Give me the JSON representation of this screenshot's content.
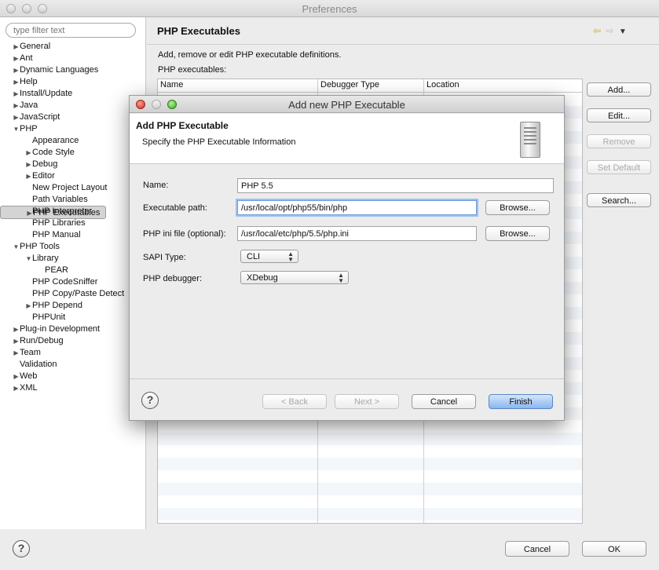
{
  "window": {
    "title": "Preferences"
  },
  "sidebar": {
    "filter_placeholder": "type filter text",
    "items": [
      {
        "label": "General",
        "depth": 0,
        "arrow": "▶"
      },
      {
        "label": "Ant",
        "depth": 0,
        "arrow": "▶"
      },
      {
        "label": "Dynamic Languages",
        "depth": 0,
        "arrow": "▶"
      },
      {
        "label": "Help",
        "depth": 0,
        "arrow": "▶"
      },
      {
        "label": "Install/Update",
        "depth": 0,
        "arrow": "▶"
      },
      {
        "label": "Java",
        "depth": 0,
        "arrow": "▶"
      },
      {
        "label": "JavaScript",
        "depth": 0,
        "arrow": "▶"
      },
      {
        "label": "PHP",
        "depth": 0,
        "arrow": "▼"
      },
      {
        "label": "Appearance",
        "depth": 1,
        "arrow": ""
      },
      {
        "label": "Code Style",
        "depth": 1,
        "arrow": "▶"
      },
      {
        "label": "Debug",
        "depth": 1,
        "arrow": "▶"
      },
      {
        "label": "Editor",
        "depth": 1,
        "arrow": "▶"
      },
      {
        "label": "New Project Layout",
        "depth": 1,
        "arrow": ""
      },
      {
        "label": "Path Variables",
        "depth": 1,
        "arrow": ""
      },
      {
        "label": "PHP Executables",
        "depth": 1,
        "arrow": "▶",
        "selected": true
      },
      {
        "label": "PHP Interpreter",
        "depth": 1,
        "arrow": ""
      },
      {
        "label": "PHP Libraries",
        "depth": 1,
        "arrow": ""
      },
      {
        "label": "PHP Manual",
        "depth": 1,
        "arrow": ""
      },
      {
        "label": "PHP Tools",
        "depth": 0,
        "arrow": "▼"
      },
      {
        "label": "Library",
        "depth": 1,
        "arrow": "▼"
      },
      {
        "label": "PEAR",
        "depth": 2,
        "arrow": ""
      },
      {
        "label": "PHP CodeSniffer",
        "depth": 1,
        "arrow": ""
      },
      {
        "label": "PHP Copy/Paste Detect",
        "depth": 1,
        "arrow": ""
      },
      {
        "label": "PHP Depend",
        "depth": 1,
        "arrow": "▶"
      },
      {
        "label": "PHPUnit",
        "depth": 1,
        "arrow": ""
      },
      {
        "label": "Plug-in Development",
        "depth": 0,
        "arrow": "▶"
      },
      {
        "label": "Run/Debug",
        "depth": 0,
        "arrow": "▶"
      },
      {
        "label": "Team",
        "depth": 0,
        "arrow": "▶"
      },
      {
        "label": "Validation",
        "depth": 0,
        "arrow": ""
      },
      {
        "label": "Web",
        "depth": 0,
        "arrow": "▶"
      },
      {
        "label": "XML",
        "depth": 0,
        "arrow": "▶"
      }
    ]
  },
  "pane": {
    "title": "PHP Executables",
    "nav_back": "⇦",
    "nav_forward": "⇨",
    "nav_menu": "▼",
    "description": "Add, remove or edit PHP executable definitions.",
    "list_label": "PHP executables:",
    "columns": [
      "Name",
      "Debugger Type",
      "Location"
    ],
    "buttons": {
      "add": "Add...",
      "edit": "Edit...",
      "remove": "Remove",
      "set_default": "Set Default",
      "search": "Search..."
    }
  },
  "footer": {
    "help": "?",
    "cancel": "Cancel",
    "ok": "OK"
  },
  "dialog": {
    "title": "Add new PHP Executable",
    "heading": "Add PHP Executable",
    "subheading": "Specify the PHP Executable Information",
    "fields": {
      "name_label": "Name:",
      "name_value": "PHP 5.5",
      "exe_label": "Executable path:",
      "exe_value": "/usr/local/opt/php55/bin/php",
      "ini_label": "PHP ini file (optional):",
      "ini_value": "/usr/local/etc/php/5.5/php.ini",
      "browse": "Browse...",
      "sapi_label": "SAPI Type:",
      "sapi_value": "CLI",
      "debugger_label": "PHP debugger:",
      "debugger_value": "XDebug"
    },
    "buttons": {
      "help": "?",
      "back": "< Back",
      "next": "Next >",
      "cancel": "Cancel",
      "finish": "Finish"
    }
  }
}
